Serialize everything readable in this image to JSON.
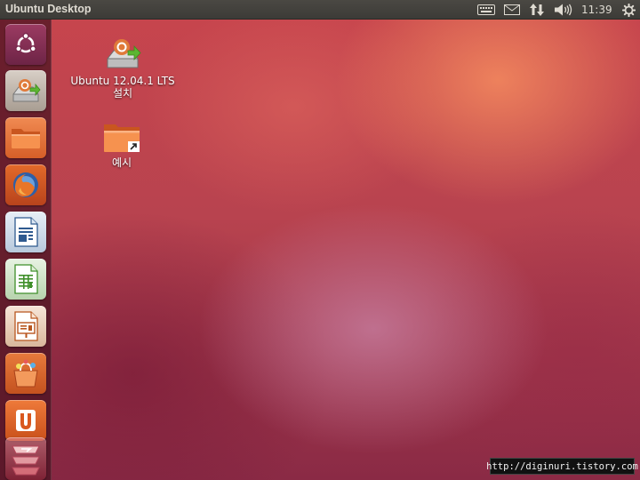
{
  "top_panel": {
    "title": "Ubuntu Desktop",
    "clock": "11:39",
    "indicators": [
      "keyboard-icon",
      "mail-icon",
      "network-icon",
      "volume-icon",
      "session-gear-icon"
    ]
  },
  "launcher": {
    "items": [
      {
        "name": "dash-home",
        "icon": "ubuntu-logo-icon"
      },
      {
        "name": "ubuntu-installer",
        "icon": "installer-icon"
      },
      {
        "name": "home-folder",
        "icon": "folder-icon"
      },
      {
        "name": "firefox",
        "icon": "firefox-icon"
      },
      {
        "name": "libreoffice-writer",
        "icon": "writer-icon"
      },
      {
        "name": "libreoffice-calc",
        "icon": "calc-icon"
      },
      {
        "name": "libreoffice-impress",
        "icon": "impress-icon"
      },
      {
        "name": "ubuntu-software-center",
        "icon": "software-center-icon"
      },
      {
        "name": "ubuntu-one",
        "icon": "ubuntu-one-icon"
      },
      {
        "name": "workspace-switcher",
        "icon": "workspace-icon"
      }
    ]
  },
  "desktop": {
    "icons": [
      {
        "line1": "Ubuntu 12.04.1 LTS",
        "line2": "설치",
        "icon": "installer-icon"
      },
      {
        "line1": "예시",
        "icon": "folder-link-icon"
      }
    ]
  },
  "watermark": "http://diginuri.tistory.com",
  "colors": {
    "panel": "#3c3b37",
    "launcher": "#5a1a2c",
    "folder_orange": "#e8763a",
    "wallpaper_red": "#c8454d"
  }
}
